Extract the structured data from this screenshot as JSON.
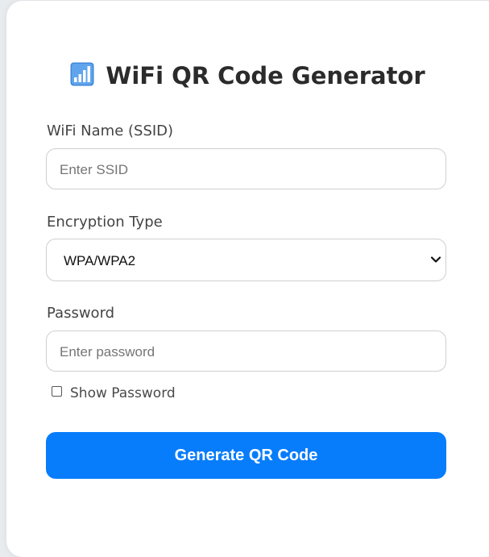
{
  "header": {
    "title": "WiFi QR Code Generator",
    "icon": "bar-chart-icon"
  },
  "form": {
    "ssid": {
      "label": "WiFi Name (SSID)",
      "placeholder": "Enter SSID",
      "value": ""
    },
    "encryption": {
      "label": "Encryption Type",
      "selected": "WPA/WPA2"
    },
    "password": {
      "label": "Password",
      "placeholder": "Enter password",
      "value": ""
    },
    "show_password": {
      "label": "Show Password",
      "checked": false
    },
    "submit_label": "Generate QR Code"
  },
  "colors": {
    "primary": "#087dfb",
    "background": "#e9ecef",
    "card": "#ffffff"
  }
}
